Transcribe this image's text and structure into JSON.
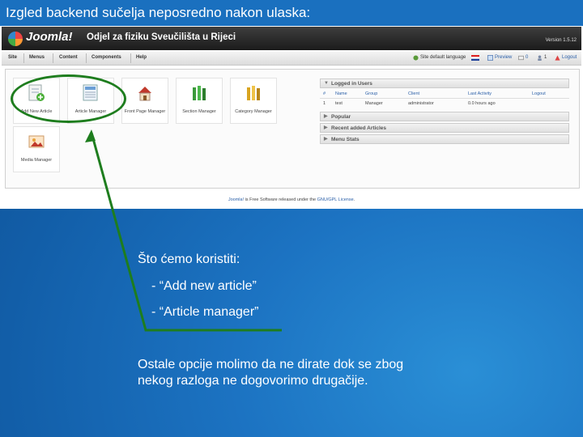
{
  "slide": {
    "title": "Izgled backend sučelja neposredno nakon ulaska:",
    "note_heading": "Što ćemo koristiti:",
    "bullet1": "- “Add new article”",
    "bullet2": "- “Article manager”",
    "other_line1": "Ostale opcije molimo da ne dirate dok se zbog",
    "other_line2": "nekog razloga ne dogovorimo drugačije."
  },
  "joomla": {
    "logo": "Joomla!",
    "site_title": "Odjel za fiziku Sveučilišta u Rijeci",
    "version": "Version 1.5.12",
    "menu": [
      "Site",
      "Menus",
      "Content",
      "Components",
      "Help"
    ],
    "status": {
      "site_default_language": "Site default language",
      "preview": "Preview",
      "messages": "0",
      "users": "1",
      "logout": "Logout"
    },
    "tiles": [
      {
        "label": "Add New Article",
        "icon": "add-article-icon"
      },
      {
        "label": "Article Manager",
        "icon": "article-manager-icon"
      },
      {
        "label": "Front Page Manager",
        "icon": "home-icon"
      },
      {
        "label": "Section Manager",
        "icon": "section-icon"
      },
      {
        "label": "Category Manager",
        "icon": "category-icon"
      },
      {
        "label": "Media Manager",
        "icon": "media-icon"
      }
    ],
    "panels": {
      "logged_in_users": "Logged in Users",
      "popular": "Popular",
      "recent_articles": "Recent added Articles",
      "menu_stats": "Menu Stats"
    },
    "table": {
      "headers": [
        "#",
        "Name",
        "Group",
        "Client",
        "Last Activity",
        "Logout"
      ],
      "row": [
        "1",
        "test",
        "Manager",
        "administrator",
        "0.0 hours ago",
        ""
      ]
    },
    "footer": {
      "joomla": "Joomla!",
      "text": " is Free Software released under the ",
      "license": "GNU/GPL License",
      "end": "."
    }
  },
  "colors": {
    "slide_blue": "#1a70bf",
    "annotation_green": "#1e7d1e",
    "link_blue": "#2a5fa8"
  }
}
